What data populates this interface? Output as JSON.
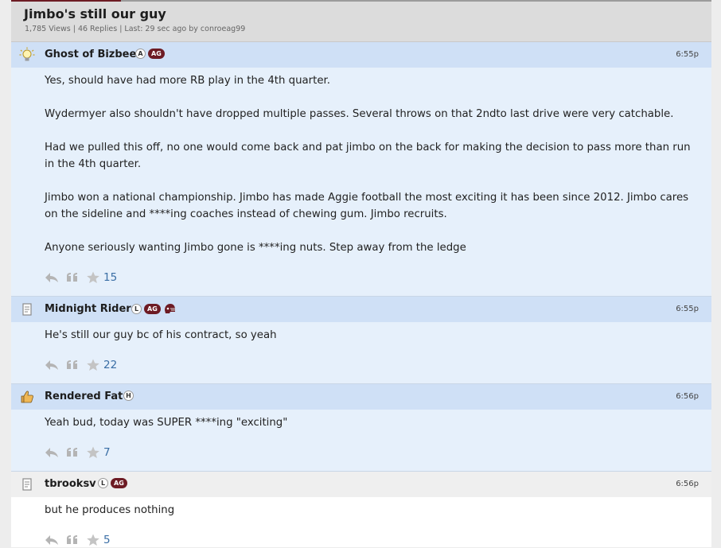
{
  "thread": {
    "title": "Jimbo's still our guy",
    "meta": "1,785 Views | 46 Replies | Last: 29 sec ago by conroeag99"
  },
  "posts": [
    {
      "username": "Ghost of Bizbee",
      "status_icon": "lightbulb-icon",
      "badges": [
        "A",
        "AG"
      ],
      "time": "6:55p",
      "paragraphs": [
        "Yes, should have had more RB play in the 4th quarter.",
        "Wydermyer also shouldn't have dropped multiple passes. Several throws on that 2ndto last drive were very catchable.",
        "Had we pulled this off, no one would come back and pat jimbo on the back for making the decision to pass more than run in the 4th quarter.",
        "Jimbo won a national championship. Jimbo has made Aggie football the most exciting it has been since 2012. Jimbo cares on the sideline and ****ing coaches instead of chewing gum. Jimbo recruits.",
        "Anyone seriously wanting Jimbo gone is ****ing nuts. Step away from the ledge"
      ],
      "stars": "15"
    },
    {
      "username": "Midnight Rider",
      "status_icon": "notepad-icon",
      "badges": [
        "L",
        "AG",
        "helmet"
      ],
      "time": "6:55p",
      "paragraphs": [
        "He's still our guy bc of his contract, so yeah"
      ],
      "stars": "22"
    },
    {
      "username": "Rendered Fat",
      "status_icon": "thumbs-up-icon",
      "badges": [
        "H"
      ],
      "time": "6:56p",
      "paragraphs": [
        "Yeah bud, today was SUPER ****ing \"exciting\""
      ],
      "stars": "7"
    },
    {
      "username": "tbrooksv",
      "status_icon": "notepad-icon",
      "badges": [
        "L",
        "AG"
      ],
      "time": "6:56p",
      "paragraphs": [
        "but he produces nothing"
      ],
      "stars": "5"
    }
  ],
  "colors": {
    "brand_maroon": "#6d1b24",
    "post_header_blue": "#cfe0f6",
    "post_body_blue": "#e6f0fb",
    "star_count": "#3a6ea5"
  }
}
